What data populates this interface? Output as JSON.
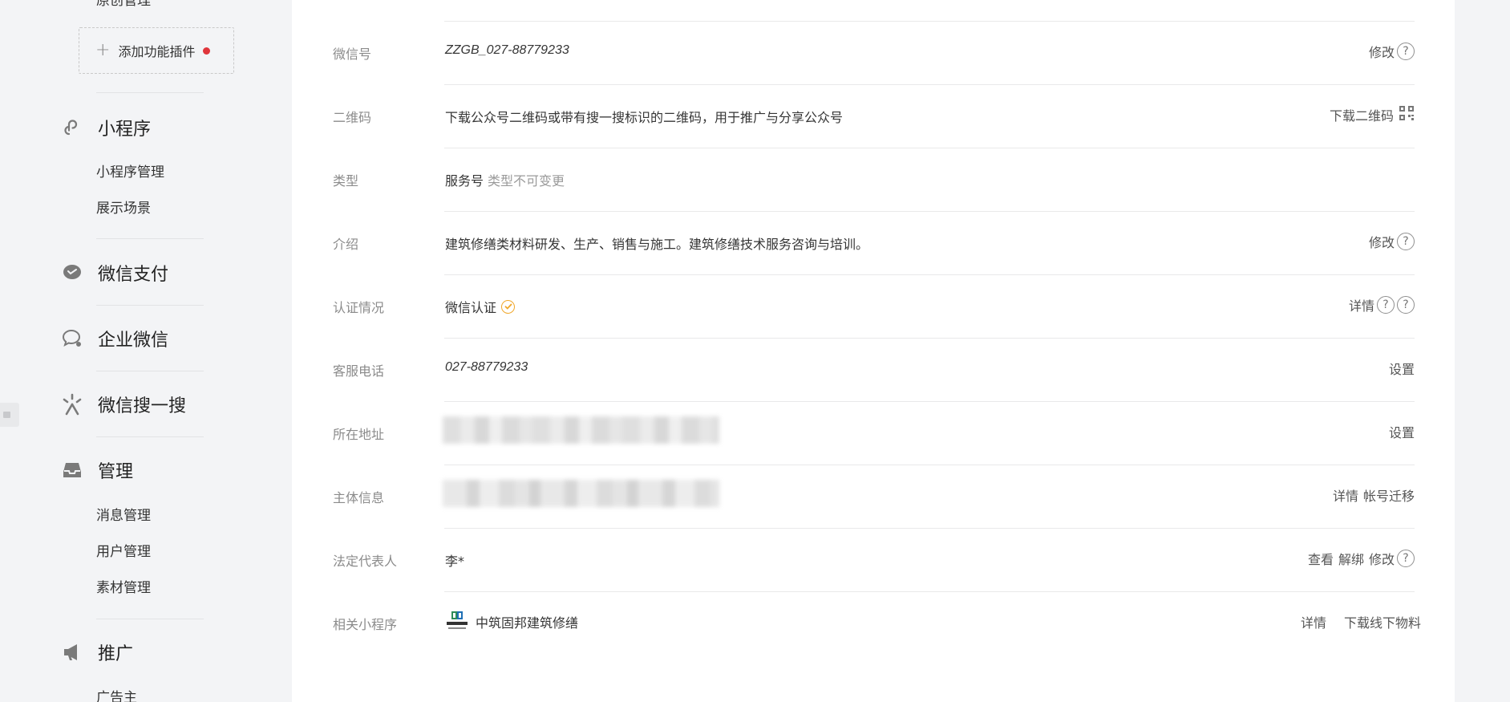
{
  "sidebar": {
    "clipped_item": "原创管理",
    "plugin_button": "添加功能插件",
    "sections": [
      {
        "icon": "link-icon",
        "title": "小程序",
        "items": [
          "小程序管理",
          "展示场景"
        ]
      },
      {
        "icon": "wechat-pay-icon",
        "title": "微信支付",
        "items": []
      },
      {
        "icon": "chat-bubble-icon",
        "title": "企业微信",
        "items": []
      },
      {
        "icon": "search-sparkle-icon",
        "title": "微信搜一搜",
        "items": []
      },
      {
        "icon": "inbox-icon",
        "title": "管理",
        "items": [
          "消息管理",
          "用户管理",
          "素材管理"
        ]
      },
      {
        "icon": "megaphone-icon",
        "title": "推广",
        "items": [
          "广告主"
        ]
      }
    ]
  },
  "info_rows": [
    {
      "label": "微信号",
      "value": "ZZGB_027-88779233",
      "actions": [
        "修改"
      ]
    },
    {
      "label": "二维码",
      "value": "下载公众号二维码或带有搜一搜标识的二维码，用于推广与分享公众号",
      "actions": [
        "下载二维码"
      ]
    },
    {
      "label": "类型",
      "value": "服务号",
      "note": "类型不可变更",
      "actions": []
    },
    {
      "label": "介绍",
      "value": "建筑修缮类材料研发、生产、销售与施工。建筑修缮技术服务咨询与培训。",
      "actions": [
        "修改"
      ]
    },
    {
      "label": "认证情况",
      "value": "微信认证",
      "actions": [
        "详情"
      ]
    },
    {
      "label": "客服电话",
      "value": "027-88779233",
      "actions": [
        "设置"
      ]
    },
    {
      "label": "所在地址",
      "value": "",
      "actions": [
        "设置"
      ]
    },
    {
      "label": "主体信息",
      "value": "",
      "actions": [
        "详情",
        "帐号迁移"
      ]
    },
    {
      "label": "法定代表人",
      "value": "李*",
      "actions": [
        "查看",
        "解绑",
        "修改"
      ]
    },
    {
      "label": "相关小程序",
      "value": "中筑固邦建筑修缮",
      "actions": [
        "详情",
        "下载线下物料"
      ]
    }
  ],
  "colors": {
    "page_bg": "#f3f4f6",
    "card_bg": "#ffffff",
    "plugin_dot": "#e0353b",
    "verified_badge": "#f0a72a",
    "label_gray": "#8b8b8b"
  }
}
